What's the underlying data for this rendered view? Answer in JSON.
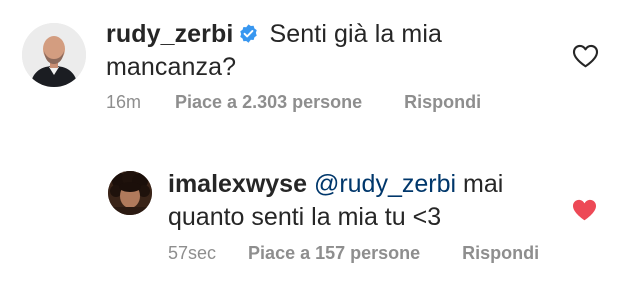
{
  "comments": [
    {
      "username": "rudy_zerbi",
      "verified": true,
      "text": "Senti già la mia mancanza?",
      "time": "16m",
      "likes": "Piace a 2.303 persone",
      "reply_label": "Rispondi",
      "liked": false
    },
    {
      "username": "imalexwyse",
      "verified": false,
      "mention": "@rudy_zerbi",
      "text": "mai quanto senti la mia tu <3",
      "time": "57sec",
      "likes": "Piace a 157 persone",
      "reply_label": "Rispondi",
      "liked": true
    }
  ],
  "colors": {
    "text": "#262626",
    "secondary": "#8e8e8e",
    "mention": "#00376b",
    "verified": "#3897f0",
    "like_red": "#ed4956"
  },
  "icons": {
    "verified": "verified-badge-icon",
    "like_outline": "heart-outline-icon",
    "like_filled": "heart-filled-icon"
  }
}
